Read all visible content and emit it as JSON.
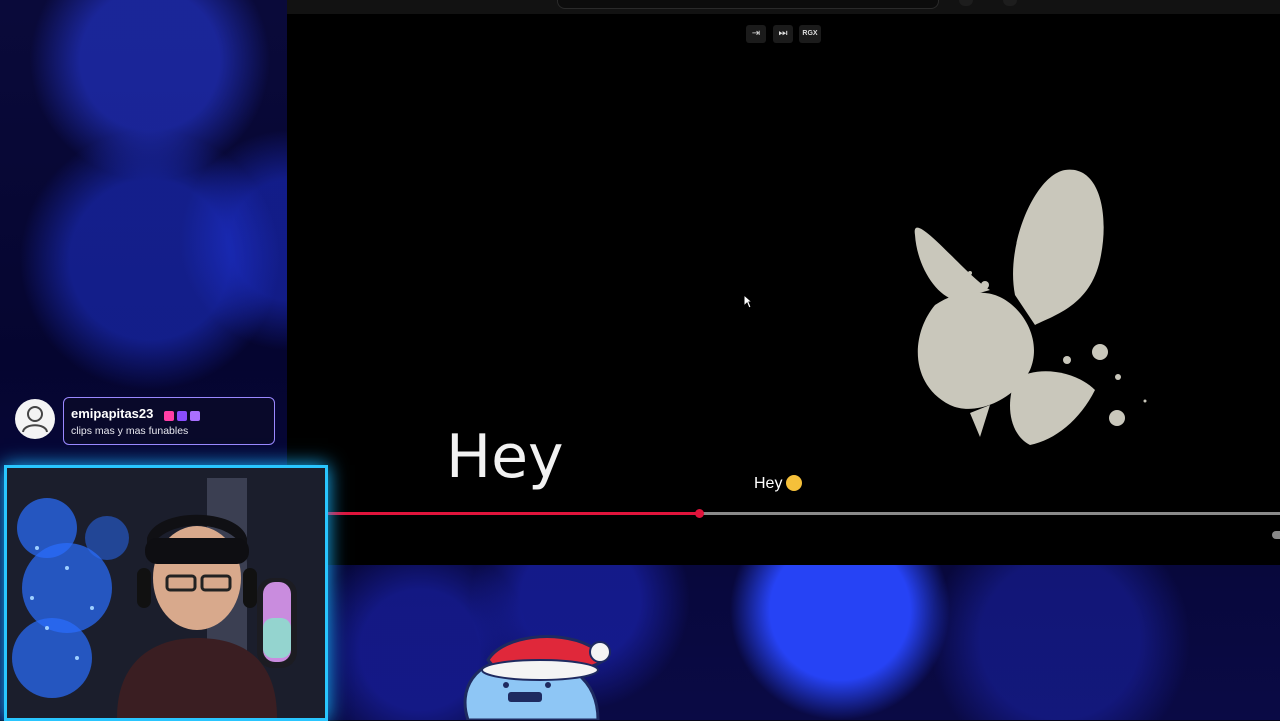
{
  "chat": {
    "username": "emipapitas23",
    "message": "clips mas y mas funables",
    "badge_colors": [
      "#ff3ea5",
      "#8a4dff",
      "#a970ff"
    ]
  },
  "player": {
    "controls": [
      {
        "icon": "exit-icon",
        "glyph": "⇥"
      },
      {
        "icon": "skip-next-icon",
        "glyph": "⏭"
      },
      {
        "icon": "rgx-icon",
        "label": "RGX"
      }
    ],
    "big_text": "Hey",
    "caption": "Hey",
    "progress": 0.39,
    "progress_color": "#e0143c"
  },
  "colors": {
    "webcam_border": "#29c6ff",
    "chat_border": "#9a88ff",
    "logo": "#c9c7bb"
  }
}
